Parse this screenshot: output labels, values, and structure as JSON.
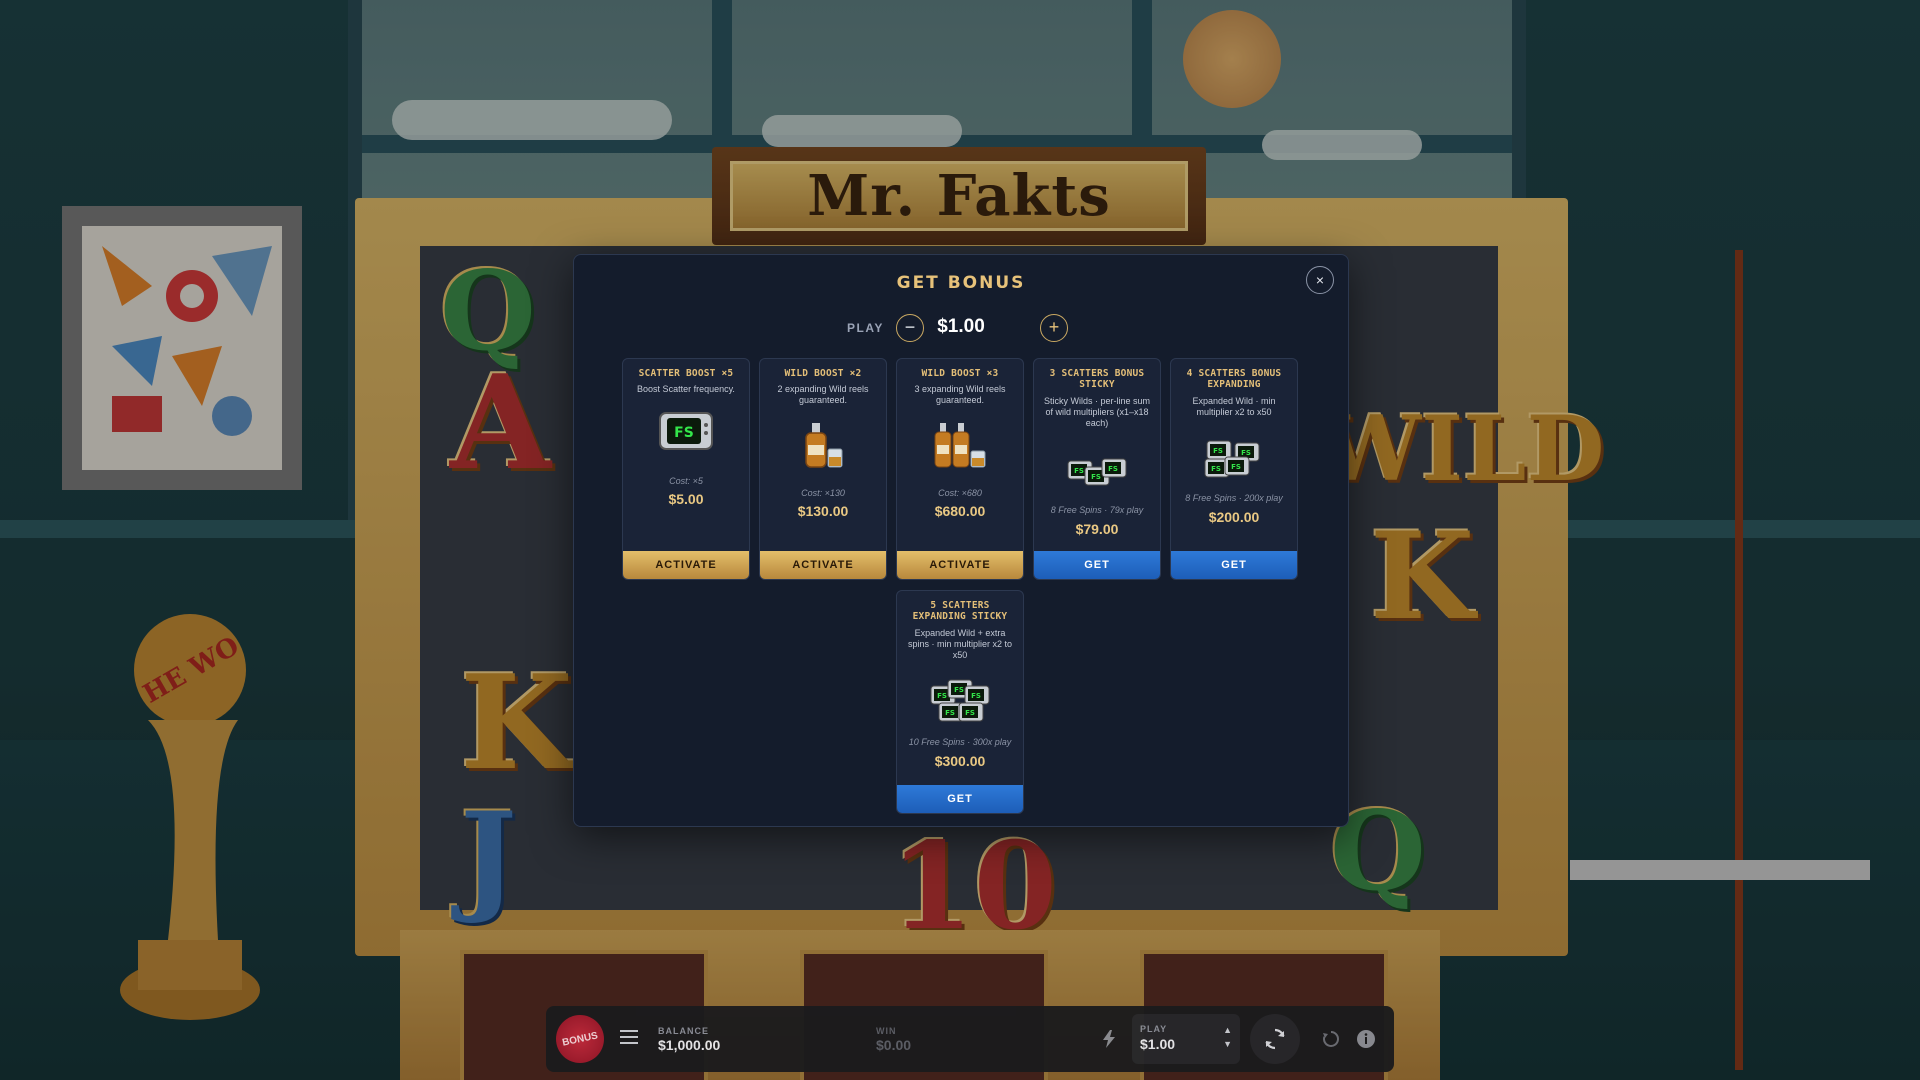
{
  "game": {
    "title": "Mr. Fakts"
  },
  "modal": {
    "title": "GET BONUS",
    "play_label": "PLAY",
    "play_value": "$1.00",
    "minus": "−",
    "plus": "+",
    "close": "×"
  },
  "cards": [
    {
      "title": "SCATTER BOOST ×5",
      "desc": "Boost Scatter frequency.",
      "icon": "fs-scatter-icon",
      "note": "Cost: ×5",
      "price": "$5.00",
      "button": "ACTIVATE"
    },
    {
      "title": "WILD BOOST ×2",
      "desc": "2 expanding Wild reels guaranteed.",
      "icon": "whiskey-bottle-icon",
      "note": "Cost: ×130",
      "price": "$130.00",
      "button": "ACTIVATE"
    },
    {
      "title": "WILD BOOST ×3",
      "desc": "3 expanding Wild reels guaranteed.",
      "icon": "whiskey-bottles-icon",
      "note": "Cost: ×680",
      "price": "$680.00",
      "button": "ACTIVATE"
    },
    {
      "title": "3 SCATTERS BONUS STICKY",
      "desc": "Sticky Wilds · per-line sum of wild multipliers (x1–x18 each)",
      "icon": "three-scatters-icon",
      "note": "8 Free Spins · 79x play",
      "price": "$79.00",
      "button": "GET"
    },
    {
      "title": "4 SCATTERS BONUS EXPANDING",
      "desc": "Expanded Wild · min multiplier x2 to x50",
      "icon": "four-scatters-icon",
      "note": "8 Free Spins · 200x play",
      "price": "$200.00",
      "button": "GET"
    },
    {
      "title": "5 SCATTERS EXPANDING STICKY",
      "desc": "Expanded Wild + extra spins · min multiplier x2 to x50",
      "icon": "five-scatters-icon",
      "note": "10 Free Spins · 300x play",
      "price": "$300.00",
      "button": "GET"
    }
  ],
  "hud": {
    "bonus_label": "BONUS",
    "balance_label": "BALANCE",
    "balance_value": "$1,000.00",
    "win_label": "WIN",
    "win_value": "$0.00",
    "play_label": "PLAY",
    "play_value": "$1.00"
  },
  "colors": {
    "accent_gold": "#e4bf78",
    "get_blue": "#2e7ad8",
    "modal_bg": "#141c2c",
    "bonus_red": "#c22c3d"
  }
}
